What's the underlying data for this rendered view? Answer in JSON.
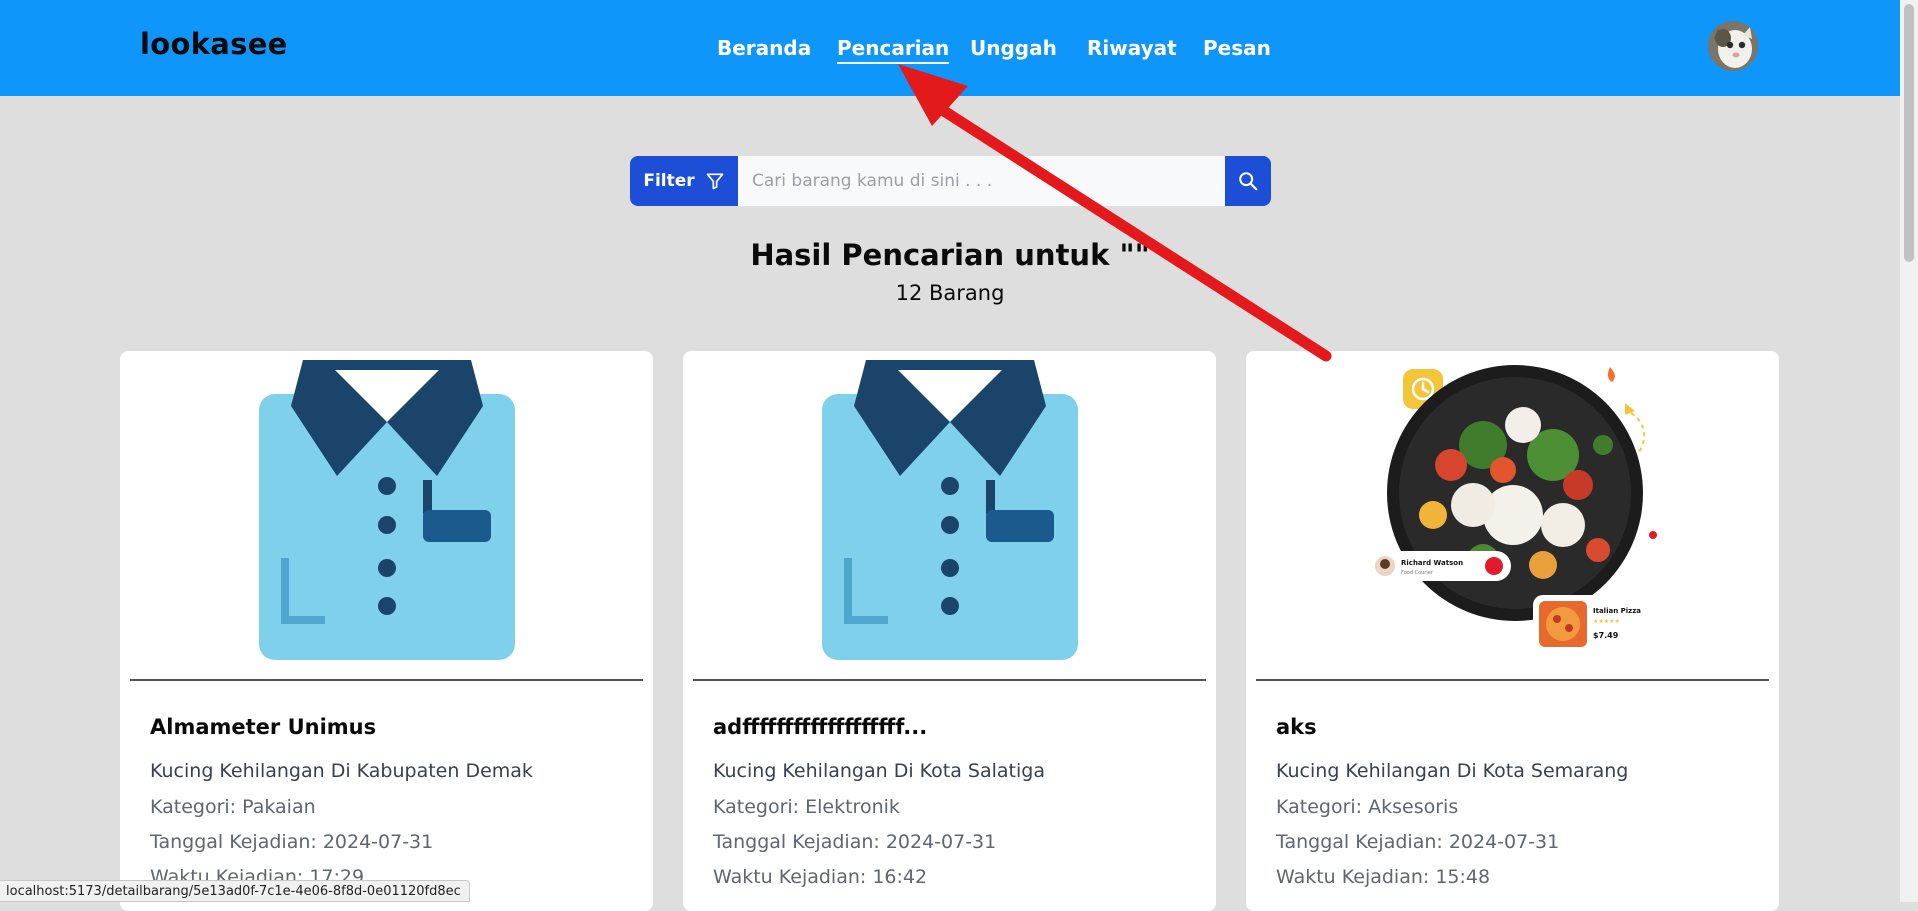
{
  "navbar": {
    "brand": "lookasee",
    "links": [
      {
        "label": "Beranda",
        "active": false
      },
      {
        "label": "Pencarian",
        "active": true
      },
      {
        "label": "Unggah",
        "active": false
      },
      {
        "label": "Riwayat",
        "active": false
      },
      {
        "label": "Pesan",
        "active": false
      }
    ],
    "avatar_icon": "cat-avatar"
  },
  "search": {
    "filter_label": "Filter",
    "filter_icon": "funnel-icon",
    "placeholder": "Cari barang kamu di sini . . .",
    "value": "",
    "search_icon": "magnifier-icon"
  },
  "results": {
    "title": "Hasil Pencarian untuk \"\"",
    "count": "12 Barang"
  },
  "items": [
    {
      "image": "shirt-illustration",
      "title": "Almameter Unimus",
      "location": "Kucing Kehilangan Di Kabupaten Demak",
      "category": "Kategori: Pakaian",
      "date": "Tanggal Kejadian: 2024-07-31",
      "time": "Waktu Kejadian: 17:29"
    },
    {
      "image": "shirt-illustration",
      "title": "adfffffffffffffffffff...",
      "location": "Kucing Kehilangan Di Kota Salatiga",
      "category": "Kategori: Elektronik",
      "date": "Tanggal Kejadian: 2024-07-31",
      "time": "Waktu Kejadian: 16:42"
    },
    {
      "image": "food-app-illustration",
      "title": "aks",
      "location": "Kucing Kehilangan Di Kota Semarang",
      "category": "Kategori: Aksesoris",
      "date": "Tanggal Kejadian: 2024-07-31",
      "time": "Waktu Kejadian: 15:48",
      "image_texts": {
        "person_name": "Richard Watson",
        "person_role": "Food Courier",
        "dish_name": "Italian Pizza",
        "dish_price": "$7.49"
      }
    }
  ],
  "status_bar": {
    "url": "localhost:5173/detailbarang/5e13ad0f-7c1e-4e06-8f8d-0e01120fd8ec"
  },
  "colors": {
    "navbar": "#0f96fb",
    "primary_button": "#1d4ed8",
    "page_background": "#dedede",
    "annotation_arrow": "#e3191c"
  }
}
